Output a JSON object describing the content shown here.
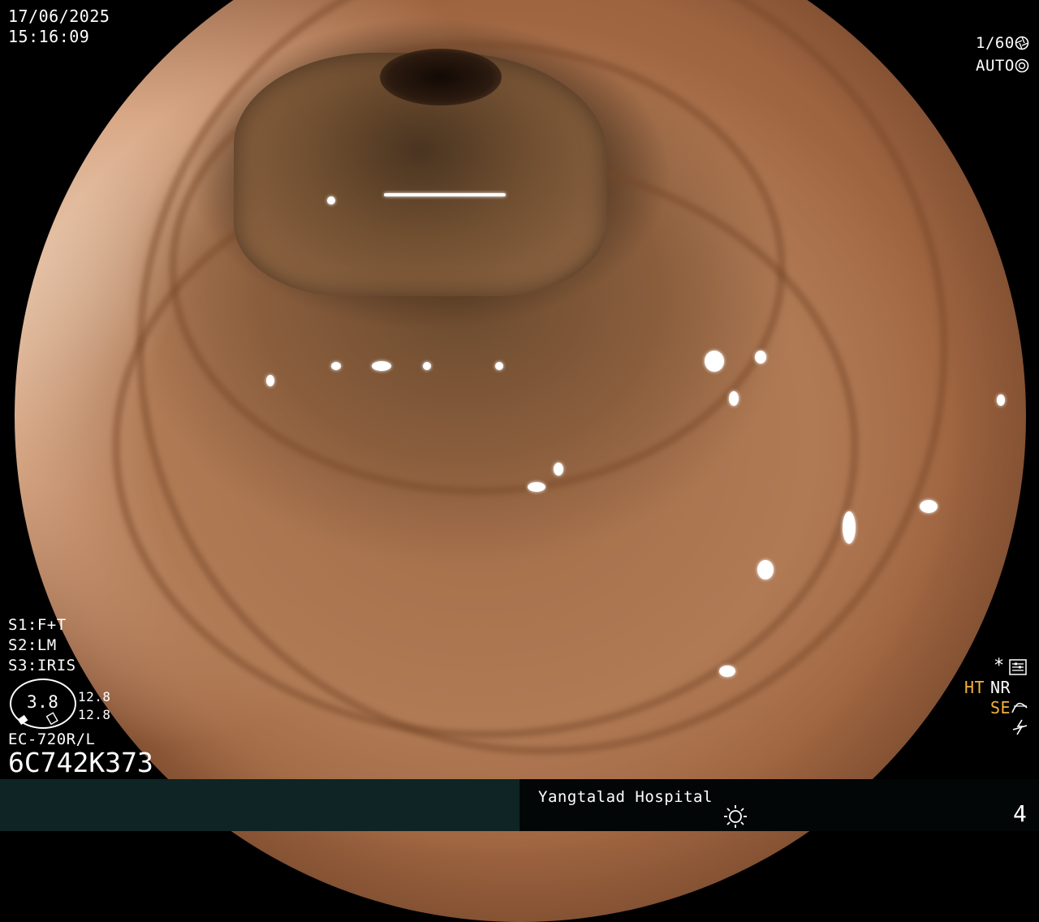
{
  "osd": {
    "date": "17/06/2025",
    "time": "15:16:09",
    "shutter": "1/60",
    "iris_mode": "AUTO",
    "s1": "S1:F+T",
    "s2": "S2:LM",
    "s3": "S3:IRIS",
    "zoom_value": "3.8",
    "zoom_a": "12.8",
    "zoom_b": "12.8",
    "scope_model": "EC-720R/L",
    "serial": "6C742K373",
    "right_star": "*",
    "ht": "HT",
    "nr": "NR",
    "se": "SE",
    "hospital": "Yangtalad Hospital",
    "image_number": "4"
  },
  "icons": [
    "shutter-icon",
    "auto-iris-icon",
    "settings-icon",
    "se-curve-icon",
    "flash-off-icon",
    "light-icon"
  ],
  "colors": {
    "accent": "#f5b03a",
    "bar_left": "#0f2424",
    "bar_right": "#020607"
  }
}
